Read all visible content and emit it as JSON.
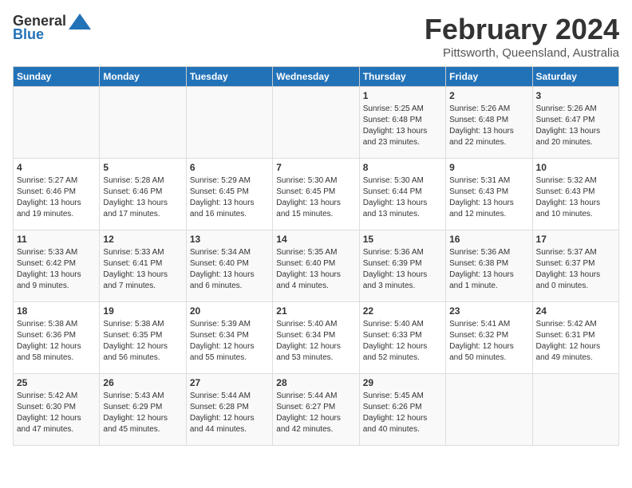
{
  "logo": {
    "general": "General",
    "blue": "Blue"
  },
  "title": {
    "month": "February 2024",
    "location": "Pittsworth, Queensland, Australia"
  },
  "headers": [
    "Sunday",
    "Monday",
    "Tuesday",
    "Wednesday",
    "Thursday",
    "Friday",
    "Saturday"
  ],
  "weeks": [
    [
      {
        "day": "",
        "info": ""
      },
      {
        "day": "",
        "info": ""
      },
      {
        "day": "",
        "info": ""
      },
      {
        "day": "",
        "info": ""
      },
      {
        "day": "1",
        "info": "Sunrise: 5:25 AM\nSunset: 6:48 PM\nDaylight: 13 hours\nand 23 minutes."
      },
      {
        "day": "2",
        "info": "Sunrise: 5:26 AM\nSunset: 6:48 PM\nDaylight: 13 hours\nand 22 minutes."
      },
      {
        "day": "3",
        "info": "Sunrise: 5:26 AM\nSunset: 6:47 PM\nDaylight: 13 hours\nand 20 minutes."
      }
    ],
    [
      {
        "day": "4",
        "info": "Sunrise: 5:27 AM\nSunset: 6:46 PM\nDaylight: 13 hours\nand 19 minutes."
      },
      {
        "day": "5",
        "info": "Sunrise: 5:28 AM\nSunset: 6:46 PM\nDaylight: 13 hours\nand 17 minutes."
      },
      {
        "day": "6",
        "info": "Sunrise: 5:29 AM\nSunset: 6:45 PM\nDaylight: 13 hours\nand 16 minutes."
      },
      {
        "day": "7",
        "info": "Sunrise: 5:30 AM\nSunset: 6:45 PM\nDaylight: 13 hours\nand 15 minutes."
      },
      {
        "day": "8",
        "info": "Sunrise: 5:30 AM\nSunset: 6:44 PM\nDaylight: 13 hours\nand 13 minutes."
      },
      {
        "day": "9",
        "info": "Sunrise: 5:31 AM\nSunset: 6:43 PM\nDaylight: 13 hours\nand 12 minutes."
      },
      {
        "day": "10",
        "info": "Sunrise: 5:32 AM\nSunset: 6:43 PM\nDaylight: 13 hours\nand 10 minutes."
      }
    ],
    [
      {
        "day": "11",
        "info": "Sunrise: 5:33 AM\nSunset: 6:42 PM\nDaylight: 13 hours\nand 9 minutes."
      },
      {
        "day": "12",
        "info": "Sunrise: 5:33 AM\nSunset: 6:41 PM\nDaylight: 13 hours\nand 7 minutes."
      },
      {
        "day": "13",
        "info": "Sunrise: 5:34 AM\nSunset: 6:40 PM\nDaylight: 13 hours\nand 6 minutes."
      },
      {
        "day": "14",
        "info": "Sunrise: 5:35 AM\nSunset: 6:40 PM\nDaylight: 13 hours\nand 4 minutes."
      },
      {
        "day": "15",
        "info": "Sunrise: 5:36 AM\nSunset: 6:39 PM\nDaylight: 13 hours\nand 3 minutes."
      },
      {
        "day": "16",
        "info": "Sunrise: 5:36 AM\nSunset: 6:38 PM\nDaylight: 13 hours\nand 1 minute."
      },
      {
        "day": "17",
        "info": "Sunrise: 5:37 AM\nSunset: 6:37 PM\nDaylight: 13 hours\nand 0 minutes."
      }
    ],
    [
      {
        "day": "18",
        "info": "Sunrise: 5:38 AM\nSunset: 6:36 PM\nDaylight: 12 hours\nand 58 minutes."
      },
      {
        "day": "19",
        "info": "Sunrise: 5:38 AM\nSunset: 6:35 PM\nDaylight: 12 hours\nand 56 minutes."
      },
      {
        "day": "20",
        "info": "Sunrise: 5:39 AM\nSunset: 6:34 PM\nDaylight: 12 hours\nand 55 minutes."
      },
      {
        "day": "21",
        "info": "Sunrise: 5:40 AM\nSunset: 6:34 PM\nDaylight: 12 hours\nand 53 minutes."
      },
      {
        "day": "22",
        "info": "Sunrise: 5:40 AM\nSunset: 6:33 PM\nDaylight: 12 hours\nand 52 minutes."
      },
      {
        "day": "23",
        "info": "Sunrise: 5:41 AM\nSunset: 6:32 PM\nDaylight: 12 hours\nand 50 minutes."
      },
      {
        "day": "24",
        "info": "Sunrise: 5:42 AM\nSunset: 6:31 PM\nDaylight: 12 hours\nand 49 minutes."
      }
    ],
    [
      {
        "day": "25",
        "info": "Sunrise: 5:42 AM\nSunset: 6:30 PM\nDaylight: 12 hours\nand 47 minutes."
      },
      {
        "day": "26",
        "info": "Sunrise: 5:43 AM\nSunset: 6:29 PM\nDaylight: 12 hours\nand 45 minutes."
      },
      {
        "day": "27",
        "info": "Sunrise: 5:44 AM\nSunset: 6:28 PM\nDaylight: 12 hours\nand 44 minutes."
      },
      {
        "day": "28",
        "info": "Sunrise: 5:44 AM\nSunset: 6:27 PM\nDaylight: 12 hours\nand 42 minutes."
      },
      {
        "day": "29",
        "info": "Sunrise: 5:45 AM\nSunset: 6:26 PM\nDaylight: 12 hours\nand 40 minutes."
      },
      {
        "day": "",
        "info": ""
      },
      {
        "day": "",
        "info": ""
      }
    ]
  ]
}
